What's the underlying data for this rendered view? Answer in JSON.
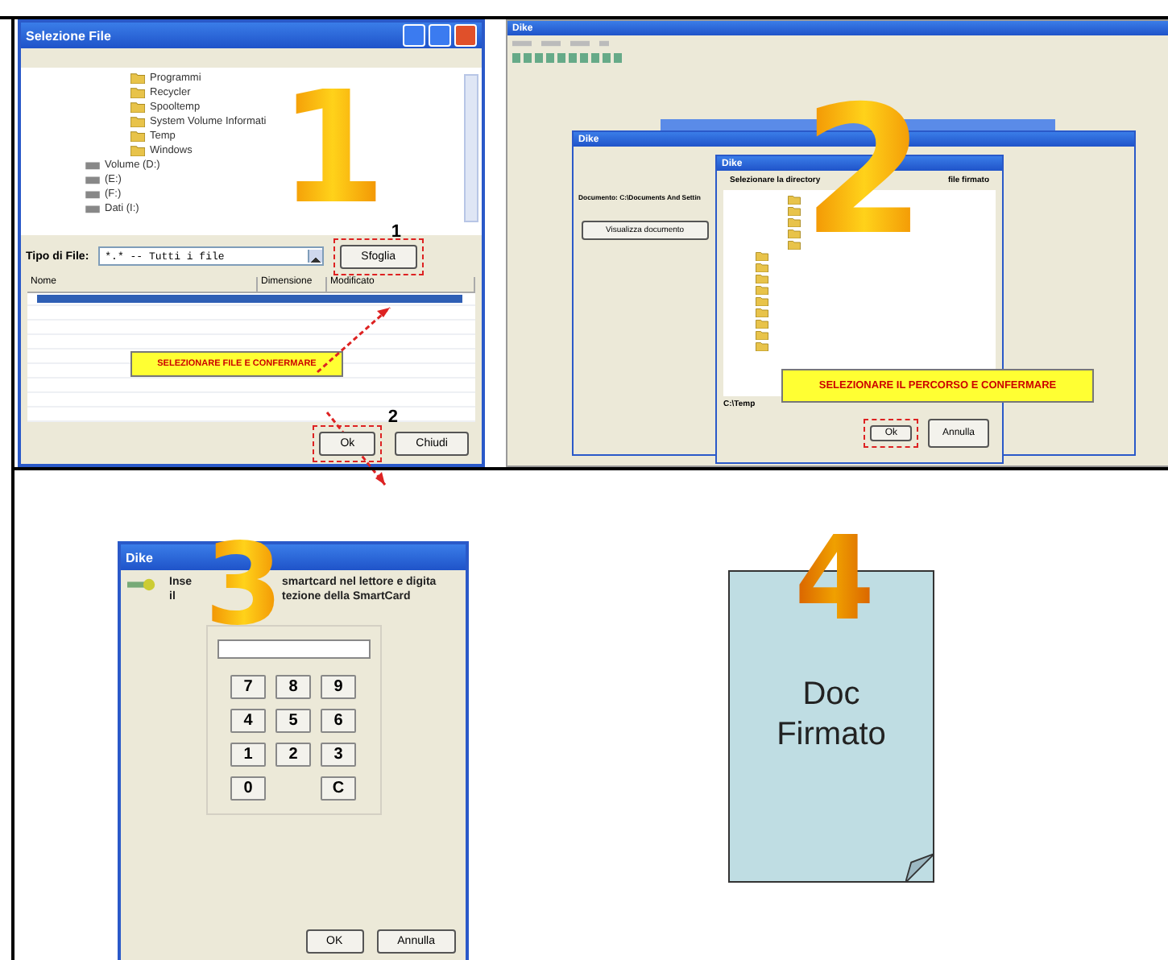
{
  "panel_1": {
    "window_title": "Selezione File",
    "step": "1",
    "tree": [
      {
        "label": "Programmi",
        "kind": "folder"
      },
      {
        "label": "Recycler",
        "kind": "folder"
      },
      {
        "label": "Spooltemp",
        "kind": "folder"
      },
      {
        "label": "System Volume Informati",
        "kind": "folder"
      },
      {
        "label": "Temp",
        "kind": "folder"
      },
      {
        "label": "Windows",
        "kind": "folder"
      },
      {
        "label": "Volume (D:)",
        "kind": "drive"
      },
      {
        "label": "(E:)",
        "kind": "drive"
      },
      {
        "label": "(F:)",
        "kind": "drive"
      },
      {
        "label": "Dati (I:)",
        "kind": "drive"
      }
    ],
    "file_type_label": "Tipo di File:",
    "file_type_value": "*.* -- Tutti i file",
    "browse_button": "Sfoglia",
    "columns": [
      "Nome",
      "Dimensione",
      "Modificato"
    ],
    "callout": "SELEZIONARE FILE E CONFERMARE",
    "ok_button": "Ok",
    "close_button": "Chiudi",
    "markers": [
      "1",
      "2"
    ]
  },
  "panel_2": {
    "app_title": "Dike",
    "window_title": "Dike",
    "dialog_title": "Dike",
    "step": "2",
    "dialog_heading_start": "Selezionare la directory",
    "dialog_heading_end": "file firmato",
    "document_label": "Documento: C:\\Documents And Settin",
    "view_button": "Visualizza documento",
    "path": "C:\\Temp",
    "callout": "SELEZIONARE IL PERCORSO E CONFERMARE",
    "ok_button": "Ok",
    "cancel_button": "Annulla"
  },
  "panel_3": {
    "window_title": "Dike",
    "step": "3",
    "message_lines": [
      [
        "Inse",
        "smartcard nel lettore e digita"
      ],
      [
        "il",
        "tezione della SmartCard"
      ]
    ],
    "keys": [
      "7",
      "8",
      "9",
      "4",
      "5",
      "6",
      "1",
      "2",
      "3",
      "0",
      "C"
    ],
    "ok_button": "OK",
    "cancel_button": "Annulla"
  },
  "panel_4": {
    "step": "4",
    "document_lines": [
      "Doc",
      "Firmato"
    ]
  }
}
